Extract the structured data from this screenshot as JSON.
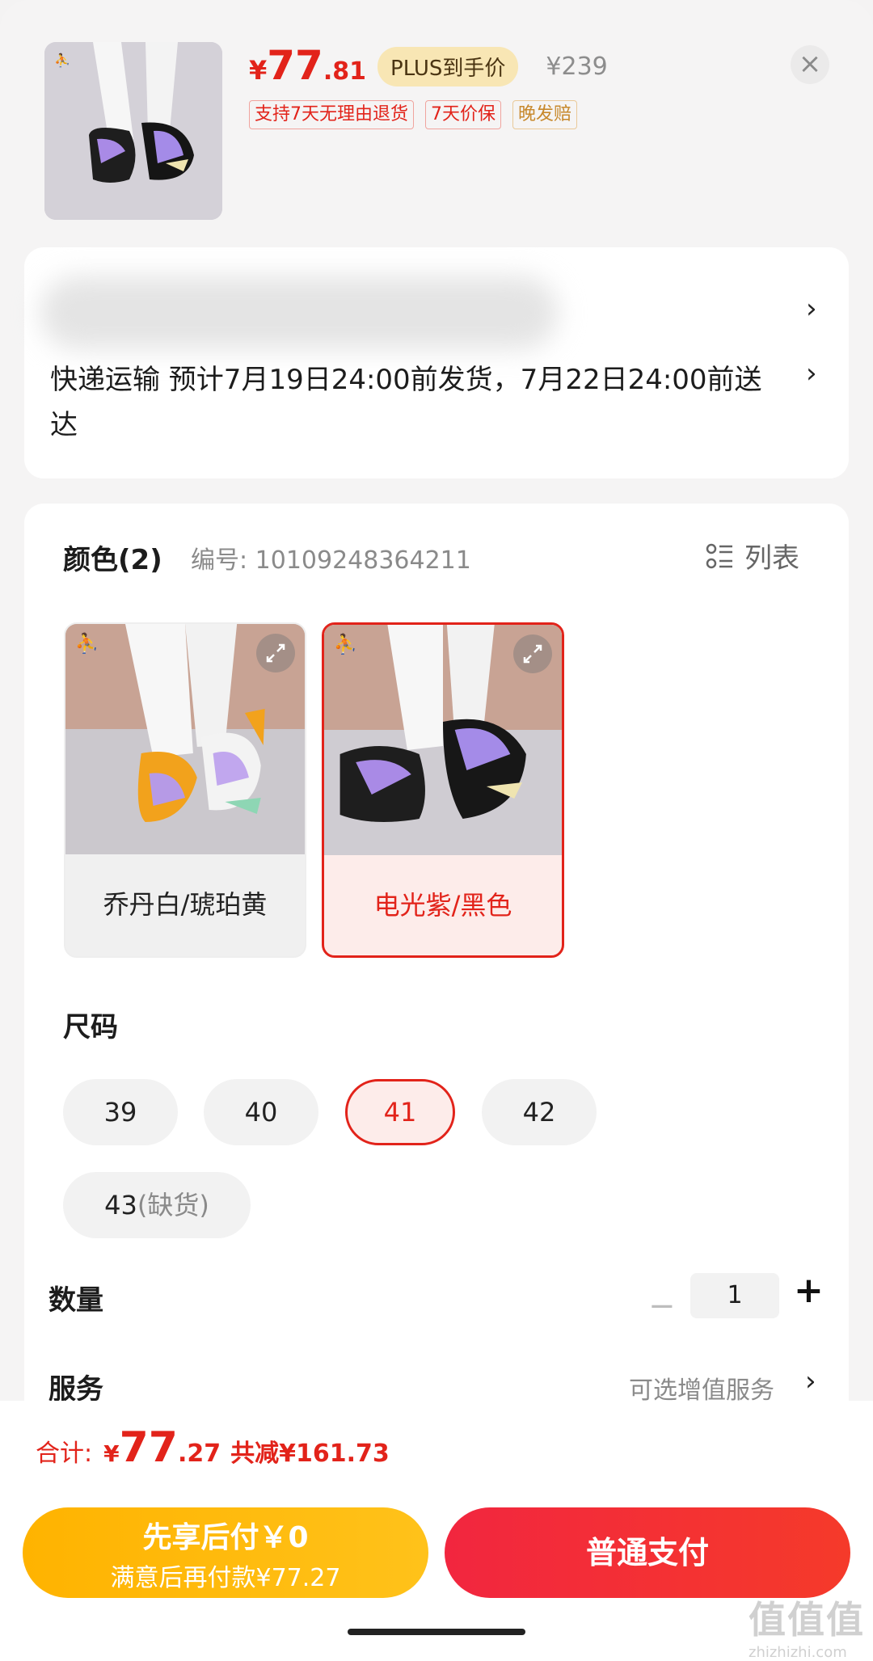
{
  "header": {
    "currency": "¥",
    "price_int": "77",
    "price_dec": ".81",
    "plus_badge": "PLUS到手价",
    "original_price": "¥239",
    "close_icon": "close-icon",
    "tags": [
      {
        "text": "支持7天无理由退货",
        "style": "red"
      },
      {
        "text": "7天价保",
        "style": "red"
      },
      {
        "text": "晚发赔",
        "style": "gold"
      }
    ]
  },
  "shipping": {
    "text": "快递运输 预计7月19日24:00前发货，7月22日24:00前送达"
  },
  "color": {
    "title": "颜色(2)",
    "sku": "编号: 10109248364211",
    "list_label": "列表",
    "options": [
      {
        "label": "乔丹白/琥珀黄",
        "selected": false
      },
      {
        "label": "电光紫/黑色",
        "selected": true
      }
    ]
  },
  "size": {
    "title": "尺码",
    "options": [
      {
        "label": "39",
        "selected": false
      },
      {
        "label": "40",
        "selected": false
      },
      {
        "label": "41",
        "selected": true
      },
      {
        "label": "42",
        "selected": false
      },
      {
        "label": "43",
        "note": "(缺货)",
        "selected": false
      }
    ]
  },
  "quantity": {
    "title": "数量",
    "value": "1",
    "minus": "−",
    "plus": "+"
  },
  "service": {
    "title": "服务",
    "text": "可选增值服务"
  },
  "bottom": {
    "total_label": "合计:",
    "currency": "¥",
    "total_int": "77",
    "total_dec": ".27",
    "save_text": "共减¥161.73",
    "pay_later_title": "先享后付￥0",
    "pay_later_sub": "满意后再付款¥77.27",
    "pay_button": "普通支付"
  },
  "watermark": {
    "main": "值值值",
    "site": "zhizhizhi.com"
  },
  "colors": {
    "accent": "#e2231a",
    "gold": "#ffb300",
    "pay_red": "#f2263f"
  }
}
